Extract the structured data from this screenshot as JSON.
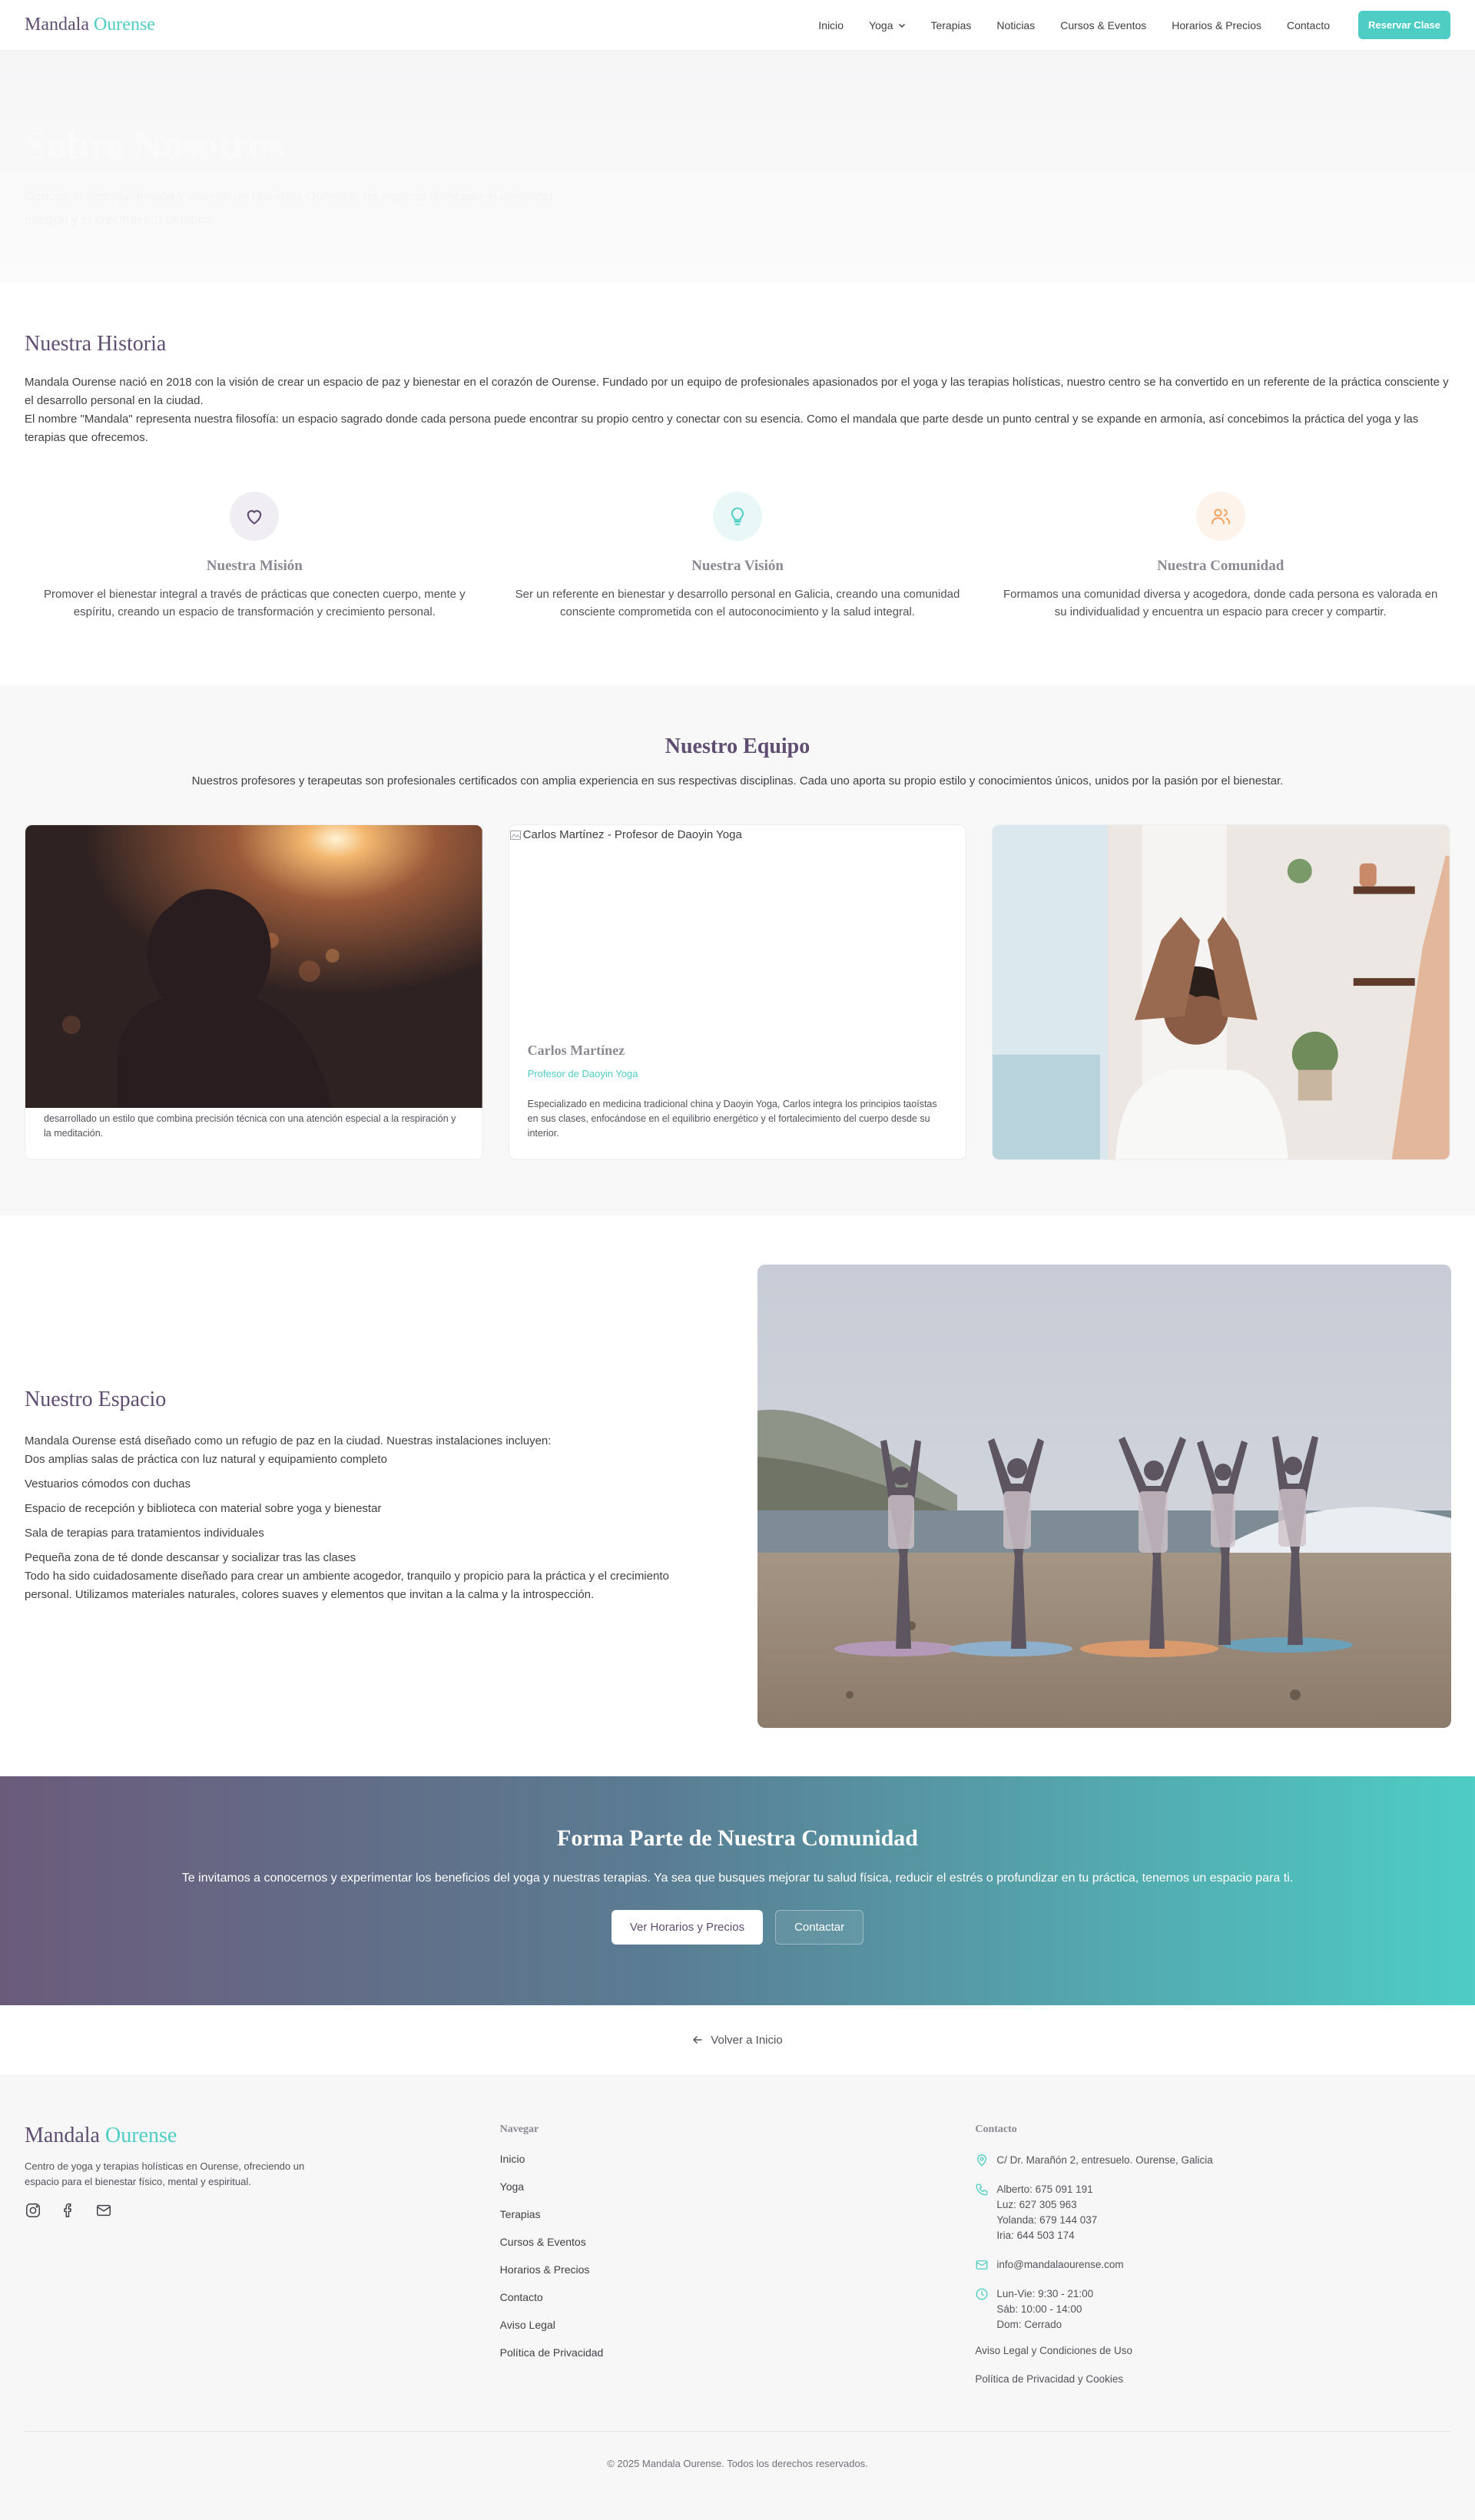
{
  "nav": {
    "logo_main": "Mandala",
    "logo_accent": "Ourense",
    "links": [
      "Inicio",
      "Yoga",
      "Terapias",
      "Noticias",
      "Cursos & Eventos",
      "Horarios & Precios",
      "Contacto"
    ],
    "cta": "Reservar Clase"
  },
  "hero": {
    "title": "Sobre Nosotros",
    "subtitle": "Conoce la historia, misión y valores de Mandala Ourense, un espacio dedicado al bienestar integral y el crecimiento personal."
  },
  "history": {
    "title": "Nuestra Historia",
    "paragraph1": "Mandala Ourense nació en 2018 con la visión de crear un espacio de paz y bienestar en el corazón de Ourense. Fundado por un equipo de profesionales apasionados por el yoga y las terapias holísticas, nuestro centro se ha convertido en un referente de la práctica consciente y el desarrollo personal en la ciudad.",
    "paragraph2": "El nombre \"Mandala\" representa nuestra filosofía: un espacio sagrado donde cada persona puede encontrar su propio centro y conectar con su esencia. Como el mandala que parte desde un punto central y se expande en armonía, así concebimos la práctica del yoga y las terapias que ofrecemos.",
    "values": [
      {
        "icon": "heart-icon",
        "title": "Nuestra Misión",
        "text": "Promover el bienestar integral a través de prácticas que conecten cuerpo, mente y espíritu, creando un espacio de transformación y crecimiento personal.",
        "color": "#5f4d72"
      },
      {
        "icon": "lightbulb-icon",
        "title": "Nuestra Visión",
        "text": "Ser un referente en bienestar y desarrollo personal en Galicia, creando una comunidad consciente comprometida con el autoconocimiento y la salud integral.",
        "color": "#4ecdc4"
      },
      {
        "icon": "users-icon",
        "title": "Nuestra Comunidad",
        "text": "Formamos una comunidad diversa y acogedora, donde cada persona es valorada en su individualidad y encuentra un espacio para crecer y compartir.",
        "color": "#f4a261"
      }
    ]
  },
  "team": {
    "title": "Nuestro Equipo",
    "intro": "Nuestros profesores y terapeutas son profesionales certificados con amplia experiencia en sus respectivas disciplinas. Cada uno aporta su propio estilo y conocimientos únicos, unidos por la pasión por el bienestar.",
    "cards": [
      {
        "text": "desarrollado un estilo que combina precisión técnica con una atención especial a la respiración y la meditación."
      },
      {
        "alt": "Carlos Martínez - Profesor de Daoyin Yoga",
        "name": "Carlos Martínez",
        "role": "Profesor de Daoyin Yoga",
        "desc": "Especializado en medicina tradicional china y Daoyin Yoga, Carlos integra los principios taoístas en sus clases, enfocándose en el equilibrio energético y el fortalecimiento del cuerpo desde su interior."
      },
      {}
    ]
  },
  "space": {
    "title": "Nuestro Espacio",
    "intro": "Mandala Ourense está diseñado como un refugio de paz en la ciudad. Nuestras instalaciones incluyen:",
    "items": [
      "Dos amplias salas de práctica con luz natural y equipamiento completo",
      "Vestuarios cómodos con duchas",
      "Espacio de recepción y biblioteca con material sobre yoga y bienestar",
      "Sala de terapias para tratamientos individuales",
      "Pequeña zona de té donde descansar y socializar tras las clases"
    ],
    "outro": "Todo ha sido cuidadosamente diseñado para crear un ambiente acogedor, tranquilo y propicio para la práctica y el crecimiento personal. Utilizamos materiales naturales, colores suaves y elementos que invitan a la calma y la introspección."
  },
  "cta": {
    "title": "Forma Parte de Nuestra Comunidad",
    "text": "Te invitamos a conocernos y experimentar los beneficios del yoga y nuestras terapias. Ya sea que busques mejorar tu salud física, reducir el estrés o profundizar en tu práctica, tenemos un espacio para ti.",
    "primary": "Ver Horarios y Precios",
    "secondary": "Contactar"
  },
  "back": {
    "label": "Volver a Inicio"
  },
  "footer": {
    "logo_main": "Mandala",
    "logo_accent": "Ourense",
    "description": "Centro de yoga y terapias holísticas en Ourense, ofreciendo un espacio para el bienestar físico, mental y espiritual.",
    "nav_title": "Navegar",
    "nav_links": [
      "Inicio",
      "Yoga",
      "Terapias",
      "Cursos & Eventos",
      "Horarios & Precios",
      "Contacto",
      "Aviso Legal",
      "Política de Privacidad"
    ],
    "contact_title": "Contacto",
    "address": "C/ Dr. Marañón 2, entresuelo. Ourense, Galicia",
    "phones": [
      "Alberto: 675 091 191",
      "Luz: 627 305 963",
      "Yolanda: 679 144 037",
      "Iria: 644 503 174"
    ],
    "email": "info@mandalaourense.com",
    "hours": [
      "Lun-Vie: 9:30 - 21:00",
      "Sáb: 10:00 - 14:00",
      "Dom: Cerrado"
    ],
    "legal_links": [
      "Aviso Legal y Condiciones de Uso",
      "Política de Privacidad y Cookies"
    ],
    "copyright": "© 2025 Mandala Ourense. Todos los derechos reservados."
  },
  "colors": {
    "brand": "#5f4d72",
    "accent": "#4ecdc4",
    "warm": "#f4a261"
  }
}
